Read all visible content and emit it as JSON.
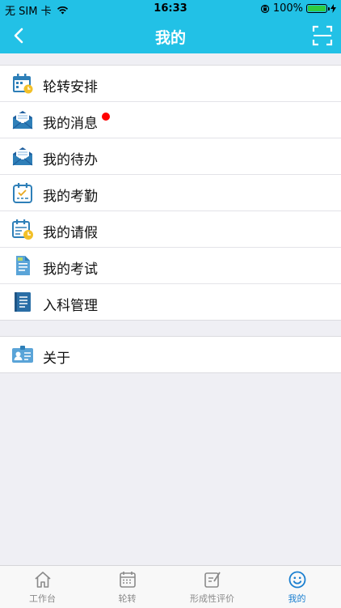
{
  "status_bar": {
    "carrier": "无 SIM 卡",
    "time": "16:33",
    "battery": "100%",
    "battery_level": 1.0
  },
  "nav": {
    "title": "我的"
  },
  "menu": {
    "items": [
      {
        "label": "轮转安排",
        "icon": "calendar-schedule-icon"
      },
      {
        "label": "我的消息",
        "icon": "mail-icon",
        "badge": true
      },
      {
        "label": "我的待办",
        "icon": "mail-todo-icon"
      },
      {
        "label": "我的考勤",
        "icon": "attendance-calendar-icon"
      },
      {
        "label": "我的请假",
        "icon": "leave-calendar-icon"
      },
      {
        "label": "我的考试",
        "icon": "exam-document-icon"
      },
      {
        "label": "入科管理",
        "icon": "book-icon"
      }
    ],
    "about": {
      "label": "关于",
      "icon": "id-card-icon"
    }
  },
  "tabs": [
    {
      "label": "工作台",
      "icon": "home-icon"
    },
    {
      "label": "轮转",
      "icon": "calendar-grid-icon"
    },
    {
      "label": "形成性评价",
      "icon": "edit-icon"
    },
    {
      "label": "我的",
      "icon": "smiley-icon",
      "active": true
    }
  ],
  "colors": {
    "primary": "#22c1e6",
    "tab_active": "#1a7fd0",
    "badge": "#ff0000"
  }
}
